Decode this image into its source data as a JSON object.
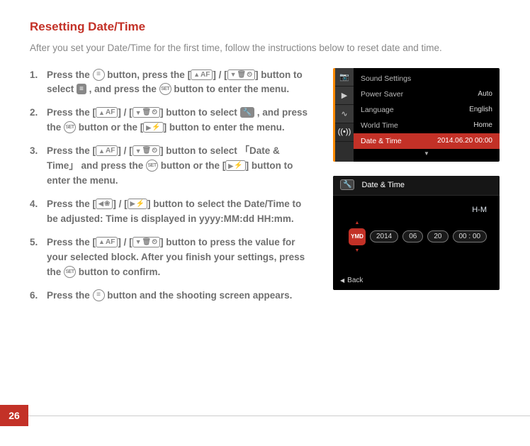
{
  "page_number": "26",
  "title": "Resetting Date/Time",
  "intro": "After you set your Date/Time for the first time, follow the instructions below to reset date and time.",
  "icons": {
    "menu": "≡",
    "set": "SET",
    "up_af": "▲AF",
    "down_group": "▼ 🗑 ⏲",
    "right_flash": "▶ ⚡",
    "left_macro": "◀ ❀",
    "cam": "📷"
  },
  "brackets": {
    "open": "[",
    "close": "]",
    "cjk_open": "「",
    "cjk_close": "」"
  },
  "steps": [
    {
      "pre": "Press the ",
      "seg2": " button, press the ",
      "seg3": " / ",
      "seg4": " button to select ",
      "seg5": " , and press the ",
      "seg6": " button to enter the menu."
    },
    {
      "pre": "Press the ",
      "seg2": " / ",
      "seg3": " button to select ",
      "seg4": " , and press the ",
      "seg5": " button or the ",
      "seg6": " button to enter the menu."
    },
    {
      "pre": "Press the ",
      "seg2": " / ",
      "seg3": " button to select ",
      "item": "Date & Time",
      "seg4": " and press the ",
      "seg5": " button or the ",
      "seg6": " button to enter the menu."
    },
    {
      "pre": "Press the ",
      "seg2": " / ",
      "seg3": " button to select the Date/Time to be adjusted: Time is displayed in yyyy:MM:dd HH:mm."
    },
    {
      "pre": "Press the ",
      "seg2": " / ",
      "seg3": " button to press the value for your selected block. After you finish your settings, press the ",
      "seg4": " button to confirm."
    },
    {
      "pre": "Press the ",
      "seg2": " button and the shooting screen appears."
    }
  ],
  "screen1": {
    "sidebar_icons": [
      "📷",
      "▶",
      "∿",
      "((•))"
    ],
    "items": [
      {
        "label": "Sound Settings",
        "value": ""
      },
      {
        "label": "Power Saver",
        "value": "Auto"
      },
      {
        "label": "Language",
        "value": "English"
      },
      {
        "label": "World Time",
        "value": "Home"
      },
      {
        "label": "Date & Time",
        "value": "2014.06.20 00:00"
      }
    ]
  },
  "screen2": {
    "header_icon": "🔧",
    "header_title": "Date & Time",
    "hm_label": "H-M",
    "ymd": "YMD",
    "pills": [
      "2014",
      "06",
      "20",
      "00 : 00"
    ],
    "back_label": "Back"
  }
}
